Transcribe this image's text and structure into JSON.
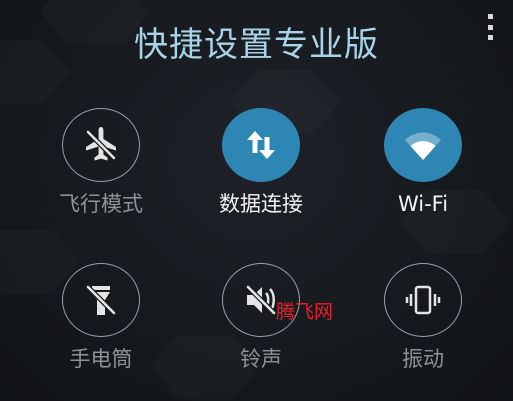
{
  "header": {
    "title": "快捷设置专业版",
    "menu_icon": "more-vert-icon"
  },
  "colors": {
    "title": "#a9d3e8",
    "active_circle": "#2e86b4",
    "inactive_border": "#9aa0a6",
    "active_label": "#f2f2f2",
    "inactive_label": "#8e9296",
    "watermark": "#e8202a"
  },
  "tiles": [
    {
      "label": "飞行模式",
      "icon": "airplane-off-icon",
      "active": false
    },
    {
      "label": "数据连接",
      "icon": "data-transfer-icon",
      "active": true
    },
    {
      "label": "Wi-Fi",
      "icon": "wifi-icon",
      "active": true
    },
    {
      "label": "手电筒",
      "icon": "flashlight-off-icon",
      "active": false
    },
    {
      "label": "铃声",
      "icon": "volume-off-icon",
      "active": false
    },
    {
      "label": "振动",
      "icon": "vibrate-icon",
      "active": false
    }
  ],
  "watermark": "腾飞网"
}
